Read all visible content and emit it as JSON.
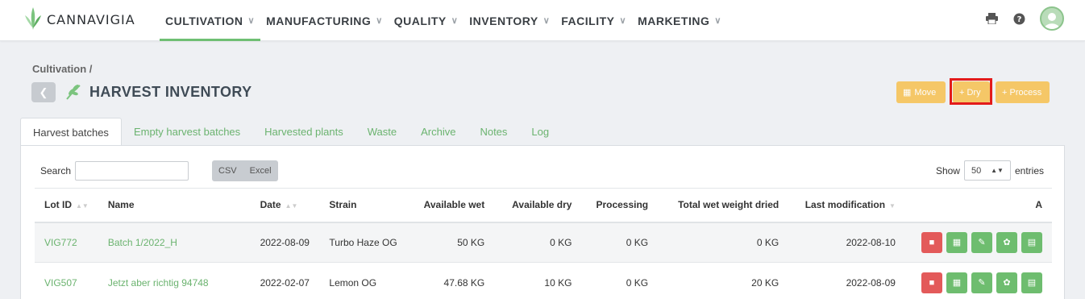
{
  "brand": {
    "name": "CANNAVIGIA"
  },
  "nav": [
    {
      "label": "CULTIVATION",
      "active": true
    },
    {
      "label": "MANUFACTURING"
    },
    {
      "label": "QUALITY"
    },
    {
      "label": "INVENTORY"
    },
    {
      "label": "FACILITY"
    },
    {
      "label": "MARKETING"
    }
  ],
  "breadcrumb": "Cultivation /",
  "page_title": "HARVEST INVENTORY",
  "actions": {
    "move": "Move",
    "dry": "+ Dry",
    "process": "+ Process"
  },
  "tabs": [
    "Harvest batches",
    "Empty harvest batches",
    "Harvested plants",
    "Waste",
    "Archive",
    "Notes",
    "Log"
  ],
  "table_controls": {
    "search_label": "Search",
    "csv": "CSV",
    "excel": "Excel",
    "show_label": "Show",
    "show_value": "50",
    "entries_label": "entries"
  },
  "columns": [
    "Lot ID",
    "Name",
    "Date",
    "Strain",
    "Available wet",
    "Available dry",
    "Processing",
    "Total wet weight dried",
    "Last modification",
    "A"
  ],
  "rows": [
    {
      "lot": "VIG772",
      "name": "Batch 1/2022_H",
      "date": "2022-08-09",
      "strain": "Turbo Haze OG",
      "wet": "50 KG",
      "dry": "0 KG",
      "processing": "0 KG",
      "total": "0 KG",
      "modified": "2022-08-10"
    },
    {
      "lot": "VIG507",
      "name": "Jetzt aber richtig 94748",
      "date": "2022-02-07",
      "strain": "Lemon OG",
      "wet": "47.68 KG",
      "dry": "10 KG",
      "processing": "0 KG",
      "total": "20 KG",
      "modified": "2022-08-09"
    }
  ],
  "colors": {
    "accent": "#6bb36f",
    "warning": "#f7c14f",
    "danger": "#e35a5a",
    "highlight": "#e31b1b"
  }
}
